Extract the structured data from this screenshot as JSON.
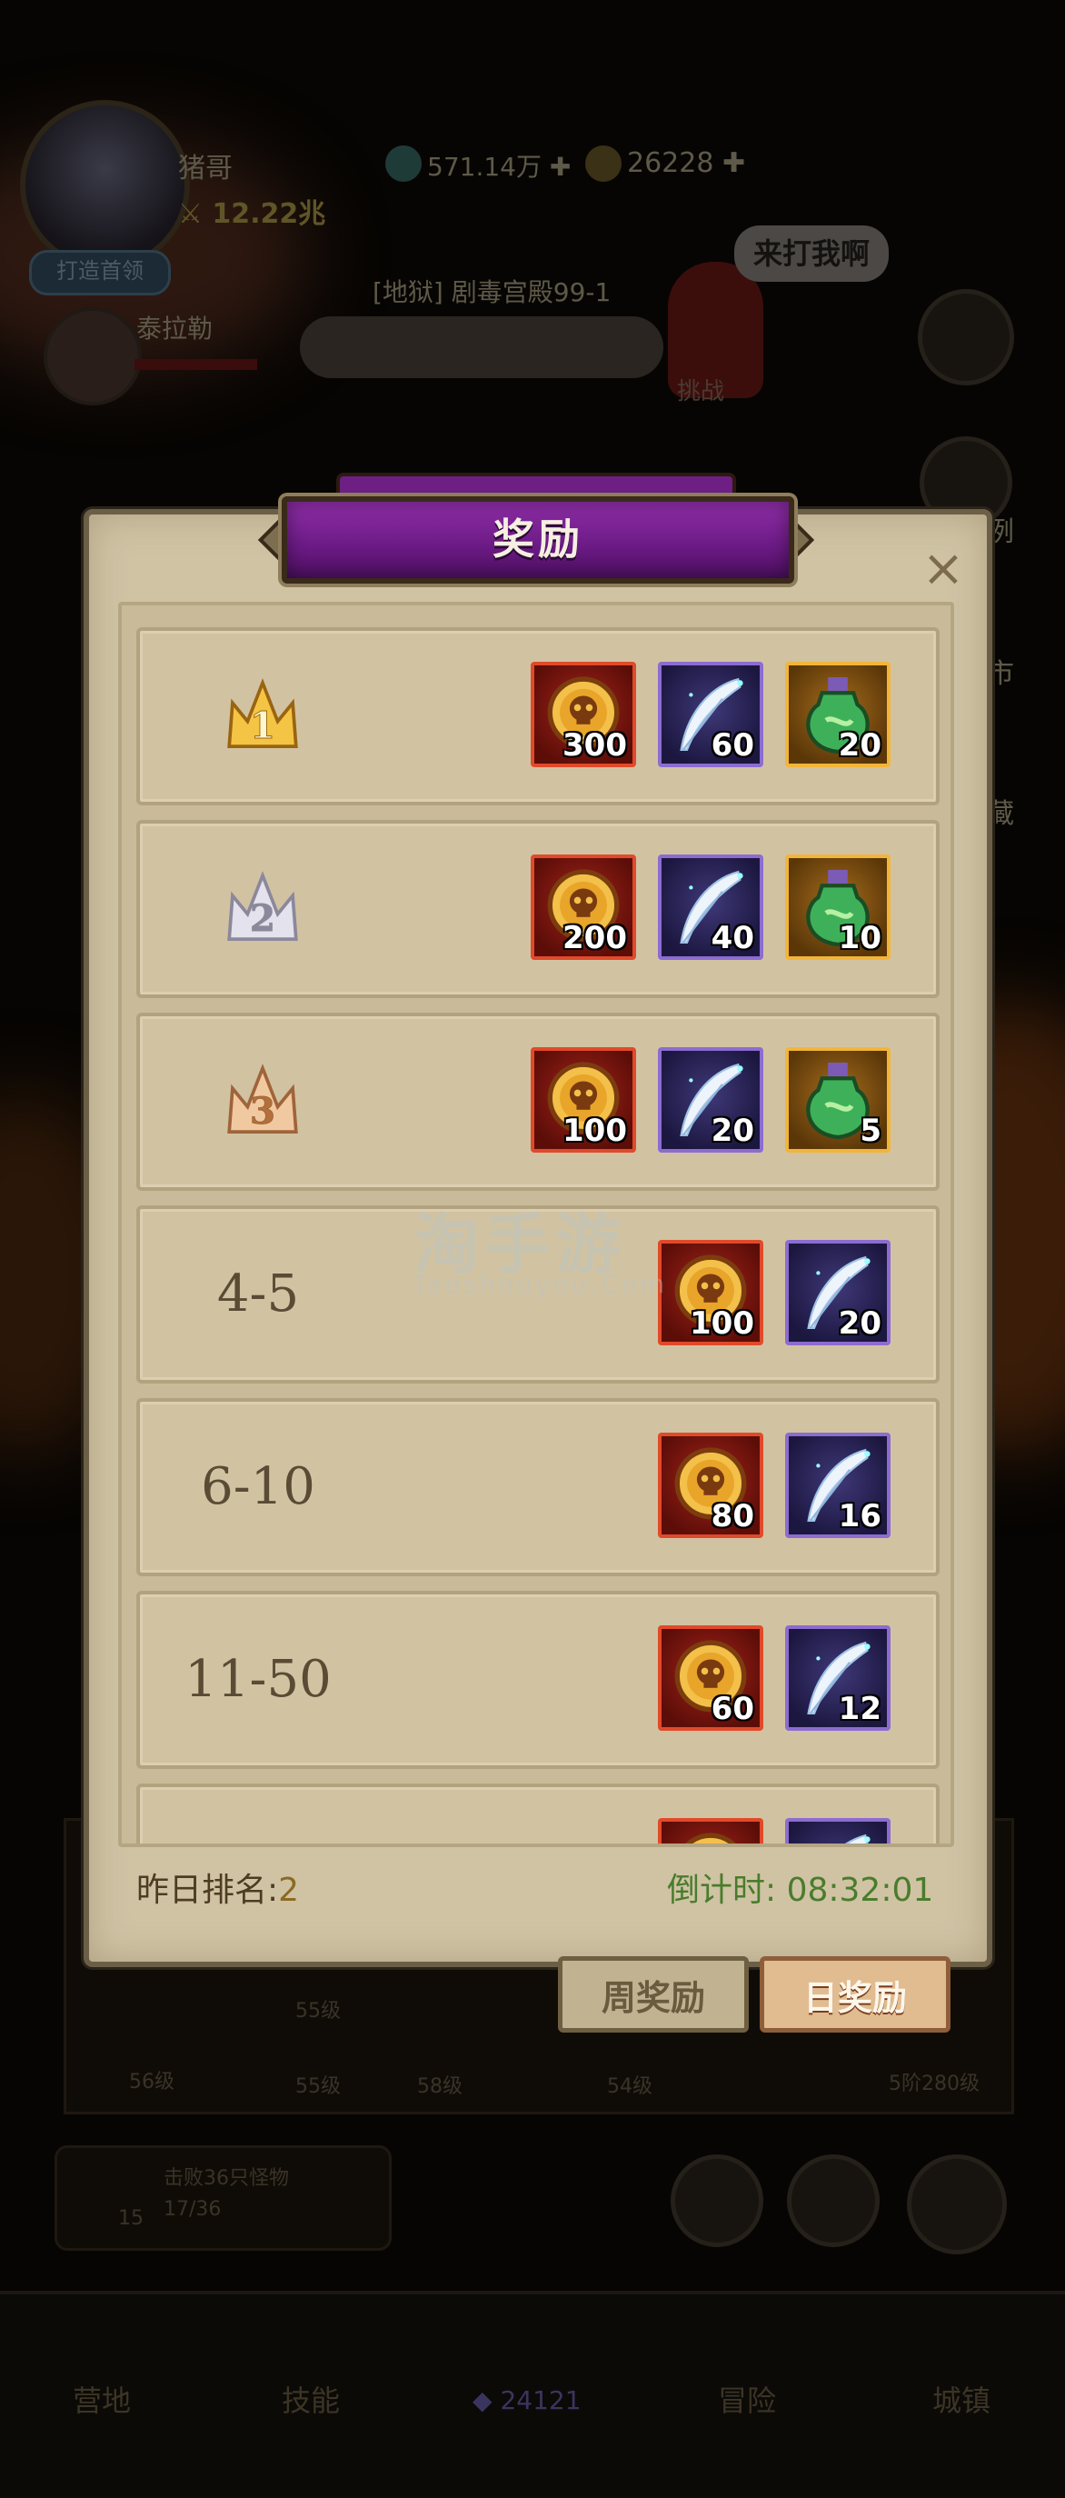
{
  "background": {
    "player_name": "猪哥",
    "power": "12.22兆",
    "gem_amount": "571.14万",
    "coin_amount": "26228",
    "badge_label": "打造首领",
    "enemy_name": "泰拉勒",
    "stage_label": "[地狱] 剧毒宫殿99-1",
    "speech_bubble": "来打我啊",
    "challenge_label": "挑战",
    "bg_level_labels": [
      "56级",
      "55级",
      "55级",
      "58级",
      "54级",
      "5阶280级"
    ],
    "bg_quest_text": "击败36只怪物",
    "bg_quest_progress": "17/36",
    "bg_orb_count": "15",
    "bottom_nav": [
      "营地",
      "技能",
      "冒险",
      "城镇"
    ],
    "bottom_currency": "24121",
    "side_labels": [
      "例",
      "市",
      "藏"
    ]
  },
  "dialog": {
    "title": "奖励",
    "close_label": "×",
    "rows": [
      {
        "rank": "1",
        "crown": "gold",
        "rewards": [
          {
            "type": "coin",
            "qty": "300"
          },
          {
            "type": "feather",
            "qty": "60"
          },
          {
            "type": "potion",
            "qty": "20"
          }
        ]
      },
      {
        "rank": "2",
        "crown": "silver",
        "rewards": [
          {
            "type": "coin",
            "qty": "200"
          },
          {
            "type": "feather",
            "qty": "40"
          },
          {
            "type": "potion",
            "qty": "10"
          }
        ]
      },
      {
        "rank": "3",
        "crown": "bronze",
        "rewards": [
          {
            "type": "coin",
            "qty": "100"
          },
          {
            "type": "feather",
            "qty": "20"
          },
          {
            "type": "potion",
            "qty": "5"
          }
        ]
      },
      {
        "rank": "4-5",
        "rewards": [
          {
            "type": "coin",
            "qty": "100"
          },
          {
            "type": "feather",
            "qty": "20"
          }
        ]
      },
      {
        "rank": "6-10",
        "rewards": [
          {
            "type": "coin",
            "qty": "80"
          },
          {
            "type": "feather",
            "qty": "16"
          }
        ]
      },
      {
        "rank": "11-50",
        "rewards": [
          {
            "type": "coin",
            "qty": "60"
          },
          {
            "type": "feather",
            "qty": "12"
          }
        ]
      },
      {
        "rank": "",
        "rewards": [
          {
            "type": "coin",
            "qty": ""
          },
          {
            "type": "feather",
            "qty": ""
          }
        ]
      }
    ],
    "yesterday_label": "昨日排名:",
    "yesterday_value": "2",
    "countdown_label": "倒计时: ",
    "countdown_value": "08:32:01",
    "tab_week": "周奖励",
    "tab_day": "日奖励"
  },
  "watermark": {
    "main": "淘手游",
    "sub": "Taoshouyou.Com"
  },
  "colors": {
    "title_purple": "#7b2596",
    "parchment": "#cfc3a4",
    "countdown_green": "#4a7c2c",
    "coin_border": "#e04a2a",
    "feather_border": "#8c6cd0",
    "potion_border": "#f2b53a"
  }
}
